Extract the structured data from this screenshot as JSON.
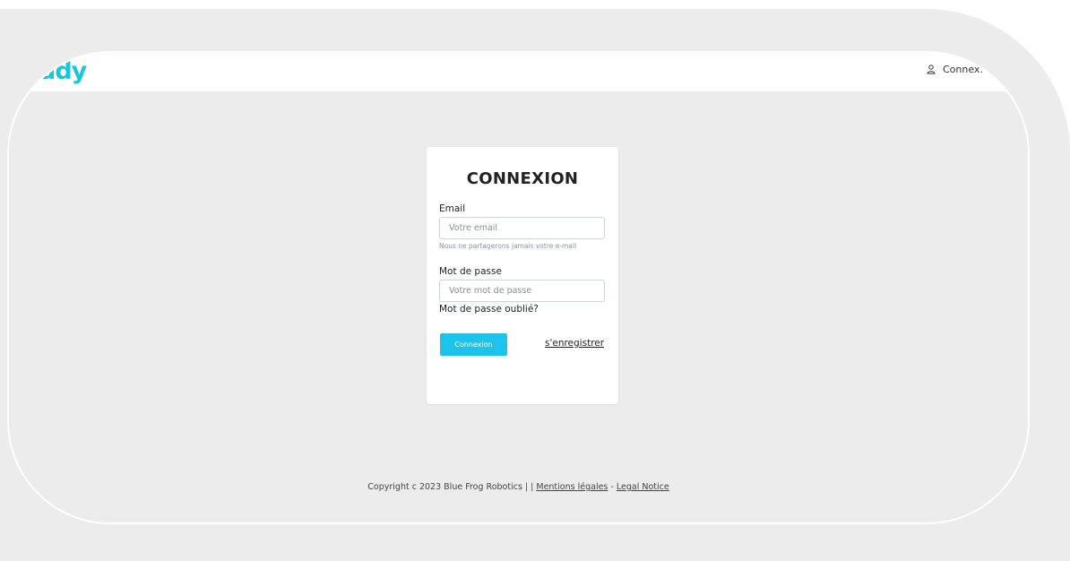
{
  "header": {
    "logo_text": "ddy",
    "login_label": "Connex."
  },
  "login_card": {
    "title": "CONNEXION",
    "email_label": "Email",
    "email_placeholder": "Votre email",
    "email_help": "Nous ne partagerons jamais votre e-mail",
    "password_label": "Mot de passe",
    "password_placeholder": "Votre mot de passe",
    "forgot_password": "Mot de passe oublié?",
    "submit_label": "Connexion",
    "register_label": "s'enregistrer"
  },
  "footer": {
    "copyright": "Copyright c 2023 Blue Frog Robotics | |",
    "legal_mentions": "Mentions légales",
    "separator": "-",
    "legal_notice": "Legal Notice"
  },
  "colors": {
    "accent": "#1ec3ec",
    "logo": "#15c9d9",
    "background": "#ececec"
  }
}
